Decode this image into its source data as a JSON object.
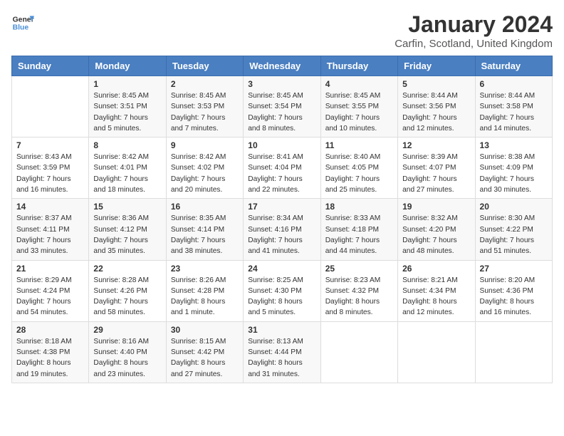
{
  "header": {
    "logo_line1": "General",
    "logo_line2": "Blue",
    "month": "January 2024",
    "location": "Carfin, Scotland, United Kingdom"
  },
  "weekdays": [
    "Sunday",
    "Monday",
    "Tuesday",
    "Wednesday",
    "Thursday",
    "Friday",
    "Saturday"
  ],
  "weeks": [
    [
      {
        "day": "",
        "sunrise": "",
        "sunset": "",
        "daylight": ""
      },
      {
        "day": "1",
        "sunrise": "Sunrise: 8:45 AM",
        "sunset": "Sunset: 3:51 PM",
        "daylight": "Daylight: 7 hours and 5 minutes."
      },
      {
        "day": "2",
        "sunrise": "Sunrise: 8:45 AM",
        "sunset": "Sunset: 3:53 PM",
        "daylight": "Daylight: 7 hours and 7 minutes."
      },
      {
        "day": "3",
        "sunrise": "Sunrise: 8:45 AM",
        "sunset": "Sunset: 3:54 PM",
        "daylight": "Daylight: 7 hours and 8 minutes."
      },
      {
        "day": "4",
        "sunrise": "Sunrise: 8:45 AM",
        "sunset": "Sunset: 3:55 PM",
        "daylight": "Daylight: 7 hours and 10 minutes."
      },
      {
        "day": "5",
        "sunrise": "Sunrise: 8:44 AM",
        "sunset": "Sunset: 3:56 PM",
        "daylight": "Daylight: 7 hours and 12 minutes."
      },
      {
        "day": "6",
        "sunrise": "Sunrise: 8:44 AM",
        "sunset": "Sunset: 3:58 PM",
        "daylight": "Daylight: 7 hours and 14 minutes."
      }
    ],
    [
      {
        "day": "7",
        "sunrise": "Sunrise: 8:43 AM",
        "sunset": "Sunset: 3:59 PM",
        "daylight": "Daylight: 7 hours and 16 minutes."
      },
      {
        "day": "8",
        "sunrise": "Sunrise: 8:42 AM",
        "sunset": "Sunset: 4:01 PM",
        "daylight": "Daylight: 7 hours and 18 minutes."
      },
      {
        "day": "9",
        "sunrise": "Sunrise: 8:42 AM",
        "sunset": "Sunset: 4:02 PM",
        "daylight": "Daylight: 7 hours and 20 minutes."
      },
      {
        "day": "10",
        "sunrise": "Sunrise: 8:41 AM",
        "sunset": "Sunset: 4:04 PM",
        "daylight": "Daylight: 7 hours and 22 minutes."
      },
      {
        "day": "11",
        "sunrise": "Sunrise: 8:40 AM",
        "sunset": "Sunset: 4:05 PM",
        "daylight": "Daylight: 7 hours and 25 minutes."
      },
      {
        "day": "12",
        "sunrise": "Sunrise: 8:39 AM",
        "sunset": "Sunset: 4:07 PM",
        "daylight": "Daylight: 7 hours and 27 minutes."
      },
      {
        "day": "13",
        "sunrise": "Sunrise: 8:38 AM",
        "sunset": "Sunset: 4:09 PM",
        "daylight": "Daylight: 7 hours and 30 minutes."
      }
    ],
    [
      {
        "day": "14",
        "sunrise": "Sunrise: 8:37 AM",
        "sunset": "Sunset: 4:11 PM",
        "daylight": "Daylight: 7 hours and 33 minutes."
      },
      {
        "day": "15",
        "sunrise": "Sunrise: 8:36 AM",
        "sunset": "Sunset: 4:12 PM",
        "daylight": "Daylight: 7 hours and 35 minutes."
      },
      {
        "day": "16",
        "sunrise": "Sunrise: 8:35 AM",
        "sunset": "Sunset: 4:14 PM",
        "daylight": "Daylight: 7 hours and 38 minutes."
      },
      {
        "day": "17",
        "sunrise": "Sunrise: 8:34 AM",
        "sunset": "Sunset: 4:16 PM",
        "daylight": "Daylight: 7 hours and 41 minutes."
      },
      {
        "day": "18",
        "sunrise": "Sunrise: 8:33 AM",
        "sunset": "Sunset: 4:18 PM",
        "daylight": "Daylight: 7 hours and 44 minutes."
      },
      {
        "day": "19",
        "sunrise": "Sunrise: 8:32 AM",
        "sunset": "Sunset: 4:20 PM",
        "daylight": "Daylight: 7 hours and 48 minutes."
      },
      {
        "day": "20",
        "sunrise": "Sunrise: 8:30 AM",
        "sunset": "Sunset: 4:22 PM",
        "daylight": "Daylight: 7 hours and 51 minutes."
      }
    ],
    [
      {
        "day": "21",
        "sunrise": "Sunrise: 8:29 AM",
        "sunset": "Sunset: 4:24 PM",
        "daylight": "Daylight: 7 hours and 54 minutes."
      },
      {
        "day": "22",
        "sunrise": "Sunrise: 8:28 AM",
        "sunset": "Sunset: 4:26 PM",
        "daylight": "Daylight: 7 hours and 58 minutes."
      },
      {
        "day": "23",
        "sunrise": "Sunrise: 8:26 AM",
        "sunset": "Sunset: 4:28 PM",
        "daylight": "Daylight: 8 hours and 1 minute."
      },
      {
        "day": "24",
        "sunrise": "Sunrise: 8:25 AM",
        "sunset": "Sunset: 4:30 PM",
        "daylight": "Daylight: 8 hours and 5 minutes."
      },
      {
        "day": "25",
        "sunrise": "Sunrise: 8:23 AM",
        "sunset": "Sunset: 4:32 PM",
        "daylight": "Daylight: 8 hours and 8 minutes."
      },
      {
        "day": "26",
        "sunrise": "Sunrise: 8:21 AM",
        "sunset": "Sunset: 4:34 PM",
        "daylight": "Daylight: 8 hours and 12 minutes."
      },
      {
        "day": "27",
        "sunrise": "Sunrise: 8:20 AM",
        "sunset": "Sunset: 4:36 PM",
        "daylight": "Daylight: 8 hours and 16 minutes."
      }
    ],
    [
      {
        "day": "28",
        "sunrise": "Sunrise: 8:18 AM",
        "sunset": "Sunset: 4:38 PM",
        "daylight": "Daylight: 8 hours and 19 minutes."
      },
      {
        "day": "29",
        "sunrise": "Sunrise: 8:16 AM",
        "sunset": "Sunset: 4:40 PM",
        "daylight": "Daylight: 8 hours and 23 minutes."
      },
      {
        "day": "30",
        "sunrise": "Sunrise: 8:15 AM",
        "sunset": "Sunset: 4:42 PM",
        "daylight": "Daylight: 8 hours and 27 minutes."
      },
      {
        "day": "31",
        "sunrise": "Sunrise: 8:13 AM",
        "sunset": "Sunset: 4:44 PM",
        "daylight": "Daylight: 8 hours and 31 minutes."
      },
      {
        "day": "",
        "sunrise": "",
        "sunset": "",
        "daylight": ""
      },
      {
        "day": "",
        "sunrise": "",
        "sunset": "",
        "daylight": ""
      },
      {
        "day": "",
        "sunrise": "",
        "sunset": "",
        "daylight": ""
      }
    ]
  ]
}
